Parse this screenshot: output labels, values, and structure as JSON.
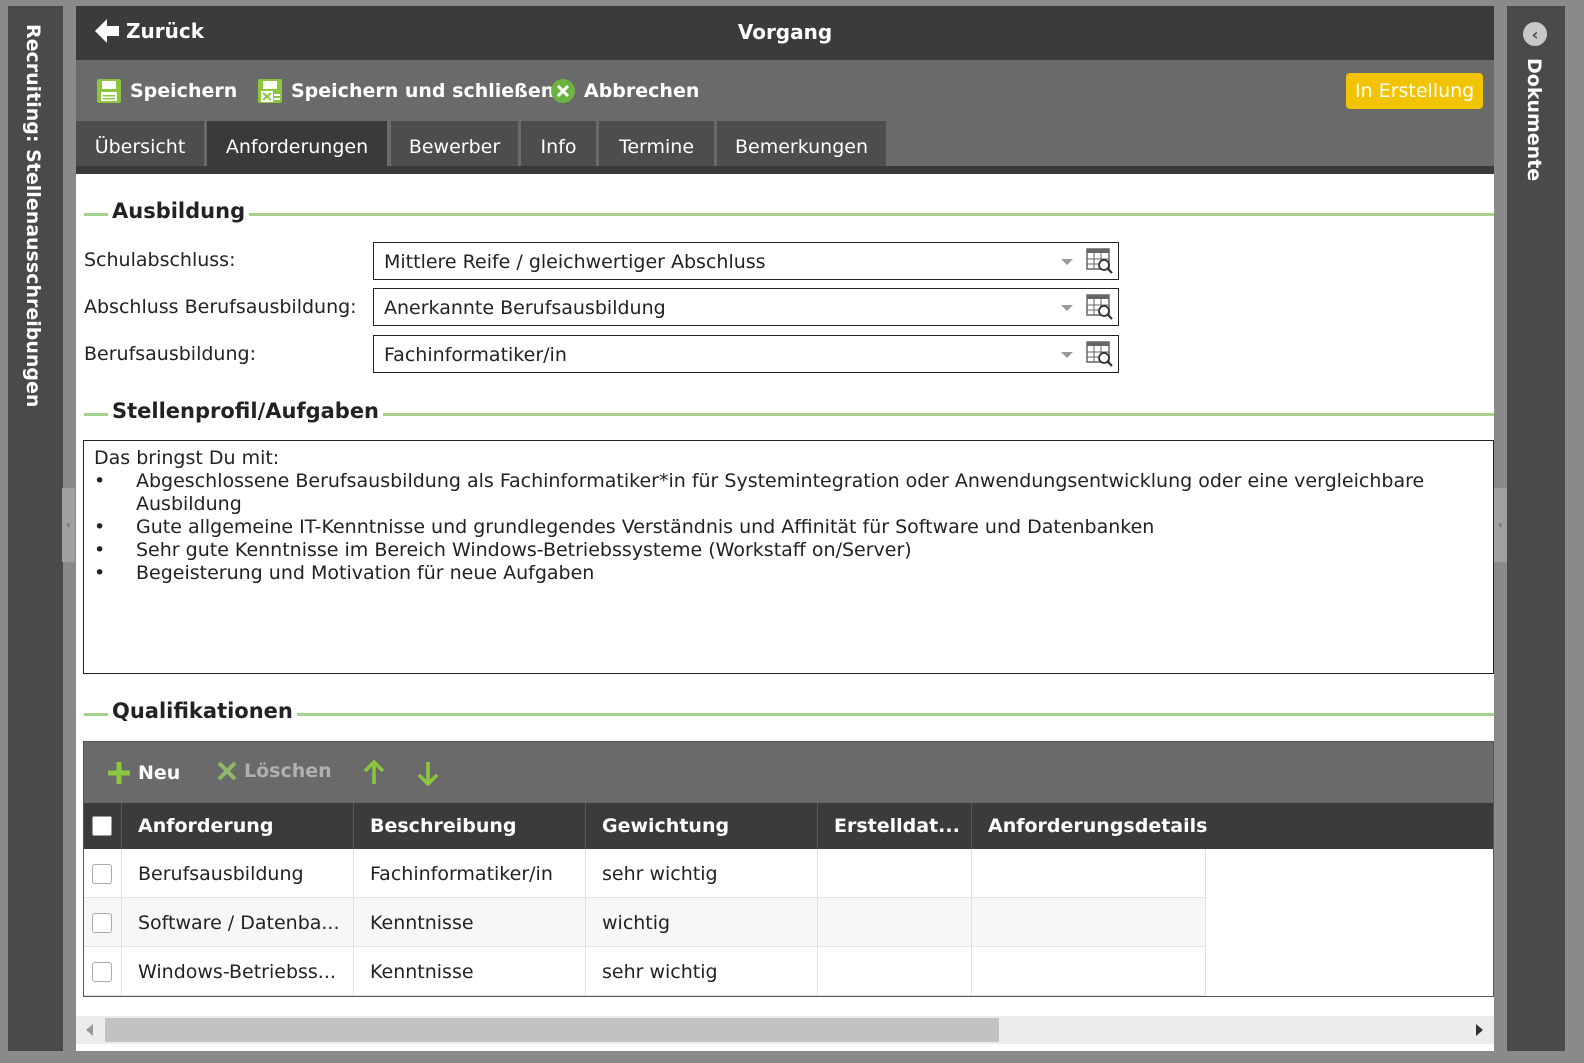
{
  "left_panel": {
    "title": "Recruiting: Stellenausschreibungen"
  },
  "right_panel": {
    "title": "Dokumente"
  },
  "header": {
    "back_label": "Zurück",
    "title": "Vorgang"
  },
  "toolbar": {
    "save_label": "Speichern",
    "save_close_label": "Speichern und schließen",
    "cancel_label": "Abbrechen",
    "status": "In Erstellung"
  },
  "tabs": [
    {
      "label": "Übersicht"
    },
    {
      "label": "Anforderungen",
      "active": true
    },
    {
      "label": "Bewerber"
    },
    {
      "label": "Info"
    },
    {
      "label": "Termine"
    },
    {
      "label": "Bemerkungen"
    }
  ],
  "ausbildung": {
    "section_title": "Ausbildung",
    "fields": [
      {
        "label": "Schulabschluss:",
        "value": "Mittlere Reife / gleichwertiger Abschluss"
      },
      {
        "label": "Abschluss Berufsausbildung:",
        "value": "Anerkannte Berufsausbildung"
      },
      {
        "label": "Berufsausbildung:",
        "value": "Fachinformatiker/in"
      }
    ]
  },
  "stellenprofil": {
    "section_title": "Stellenprofil/Aufgaben",
    "intro": "Das bringst Du mit:",
    "bullet_char": "•",
    "bullets": [
      "Abgeschlossene Berufsausbildung als Fachinformatiker*in für Systemintegration oder Anwendungsentwicklung oder eine vergleichbare Ausbildung",
      "Gute allgemeine IT-Kenntnisse und grundlegendes Verständnis und Affinität für Software und Datenbanken",
      "Sehr gute Kenntnisse im Bereich Windows-Betriebssysteme (Workstaff on/Server)",
      "Begeisterung und Motivation für neue Aufgaben"
    ]
  },
  "qualifikationen": {
    "section_title": "Qualifikationen",
    "new_label": "Neu",
    "delete_label": "Löschen",
    "columns": [
      "Anforderung",
      "Beschreibung",
      "Gewichtung",
      "Erstelldat...",
      "Anforderungsdetails"
    ],
    "rows": [
      {
        "anforderung": "Berufsausbildung",
        "beschreibung": "Fachinformatiker/in",
        "gewichtung": "sehr wichtig",
        "erstelldatum": "",
        "details": ""
      },
      {
        "anforderung": "Software / Datenba...",
        "beschreibung": "Kenntnisse",
        "gewichtung": "wichtig",
        "erstelldatum": "",
        "details": ""
      },
      {
        "anforderung": "Windows-Betriebss...",
        "beschreibung": "Kenntnisse",
        "gewichtung": "sehr wichtig",
        "erstelldatum": "",
        "details": ""
      }
    ]
  },
  "colors": {
    "accent_green": "#8cc63f",
    "section_rule": "#a8d08d",
    "status_yellow": "#f2c300",
    "cancel_green": "#6db33f"
  },
  "icons": {
    "back": "arrow-left-icon",
    "save": "floppy-disk-icon",
    "save_close": "floppy-disk-close-icon",
    "cancel": "x-circle-icon",
    "lookup": "table-search-icon",
    "add": "plus-icon",
    "delete": "x-icon",
    "move_up": "arrow-up-icon",
    "move_down": "arrow-down-icon",
    "collapse": "chevron-left-icon"
  }
}
